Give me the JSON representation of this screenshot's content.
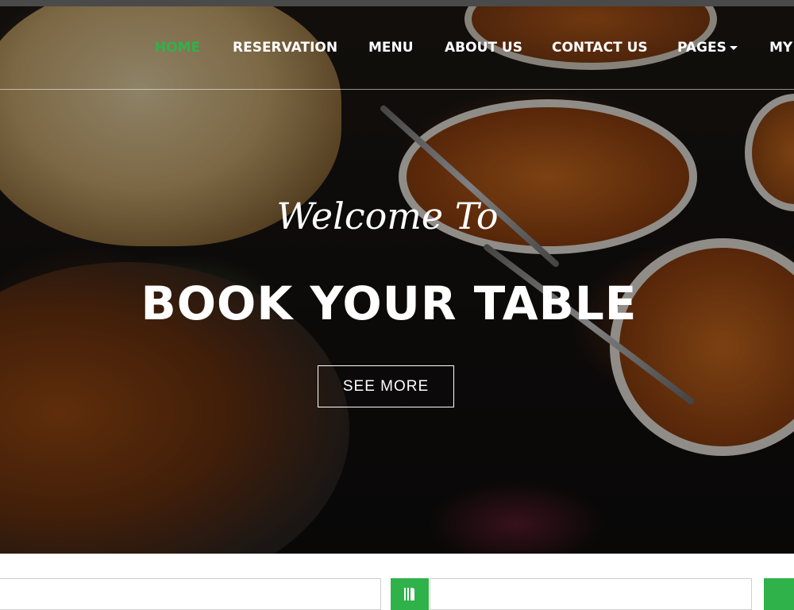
{
  "nav": {
    "items": [
      {
        "label": "HOME",
        "active": true
      },
      {
        "label": "RESERVATION",
        "active": false
      },
      {
        "label": "MENU",
        "active": false
      },
      {
        "label": "ABOUT US",
        "active": false
      },
      {
        "label": "CONTACT US",
        "active": false
      },
      {
        "label": "PAGES",
        "active": false,
        "dropdown": true
      },
      {
        "label": "MY",
        "active": false
      }
    ]
  },
  "hero": {
    "welcome": "Welcome To",
    "headline": "BOOK YOUR TABLE",
    "cta_label": "SEE MORE"
  },
  "search": {
    "icons": [
      "food-icon",
      "food-icon"
    ]
  },
  "colors": {
    "accent": "#2fb24a",
    "text_on_hero": "#ffffff",
    "overlay": "#000000"
  }
}
